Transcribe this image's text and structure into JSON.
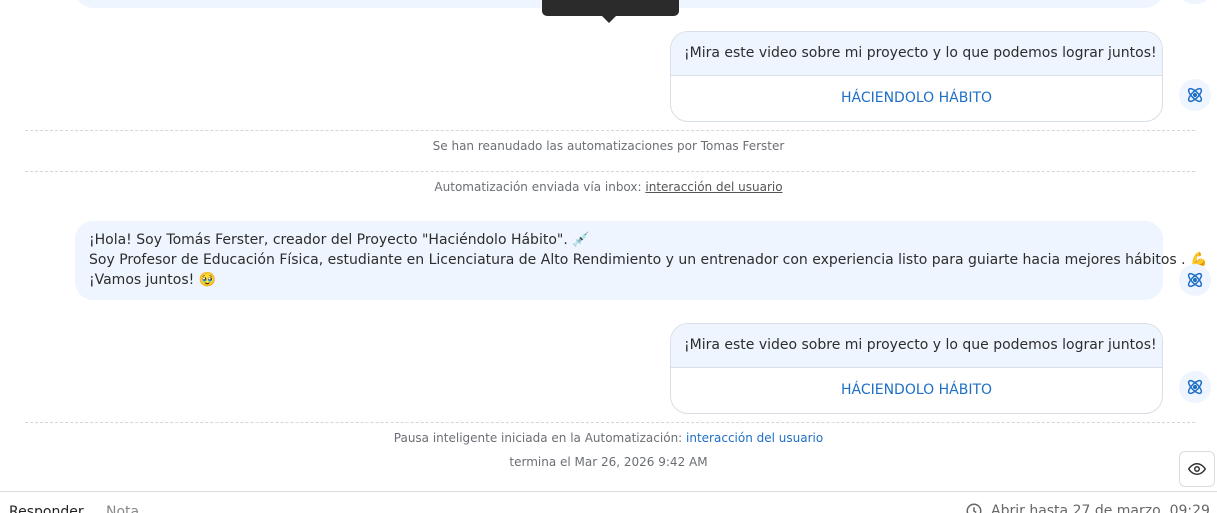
{
  "messages": {
    "promo_text": "¡Mira este video sobre mi proyecto y lo que podemos lograr juntos! 🥹",
    "promo_button": "HÁCIENDOLO HÁBITO",
    "welcome_line1": "¡Hola! Soy Tomás Ferster, creador del Proyecto \"Haciéndolo Hábito\". 💉",
    "welcome_line2": "Soy Profesor  de Educación Física, estudiante en Licenciatura de Alto Rendimiento y un  entrenador con experiencia listo para guiarte hacia mejores hábitos . 💪",
    "welcome_line3": " ¡Vamos juntos! 🥹"
  },
  "system": {
    "resumed": "Se han reanudado las automatizaciones por Tomas Ferster",
    "sent_prefix": "Automatización enviada vía inbox: ",
    "sent_link": "interacción del usuario",
    "pause_prefix": "Pausa inteligente iniciada en la Automatización: ",
    "pause_link": "interacción del usuario",
    "pause_end": "termina el Mar 26, 2026 9:42 AM"
  },
  "composer": {
    "tab_reply": "Responder",
    "tab_note": "Nota",
    "open_until": "Abrir hasta 27 de marzo, 09:29"
  },
  "icons": {
    "avatar": "automation-atom-icon",
    "eye": "eye-icon",
    "clock": "clock-icon"
  },
  "colors": {
    "bubble": "#eef5ff",
    "link": "#1f6fc5",
    "avatar_icon": "#1f6fc5"
  }
}
